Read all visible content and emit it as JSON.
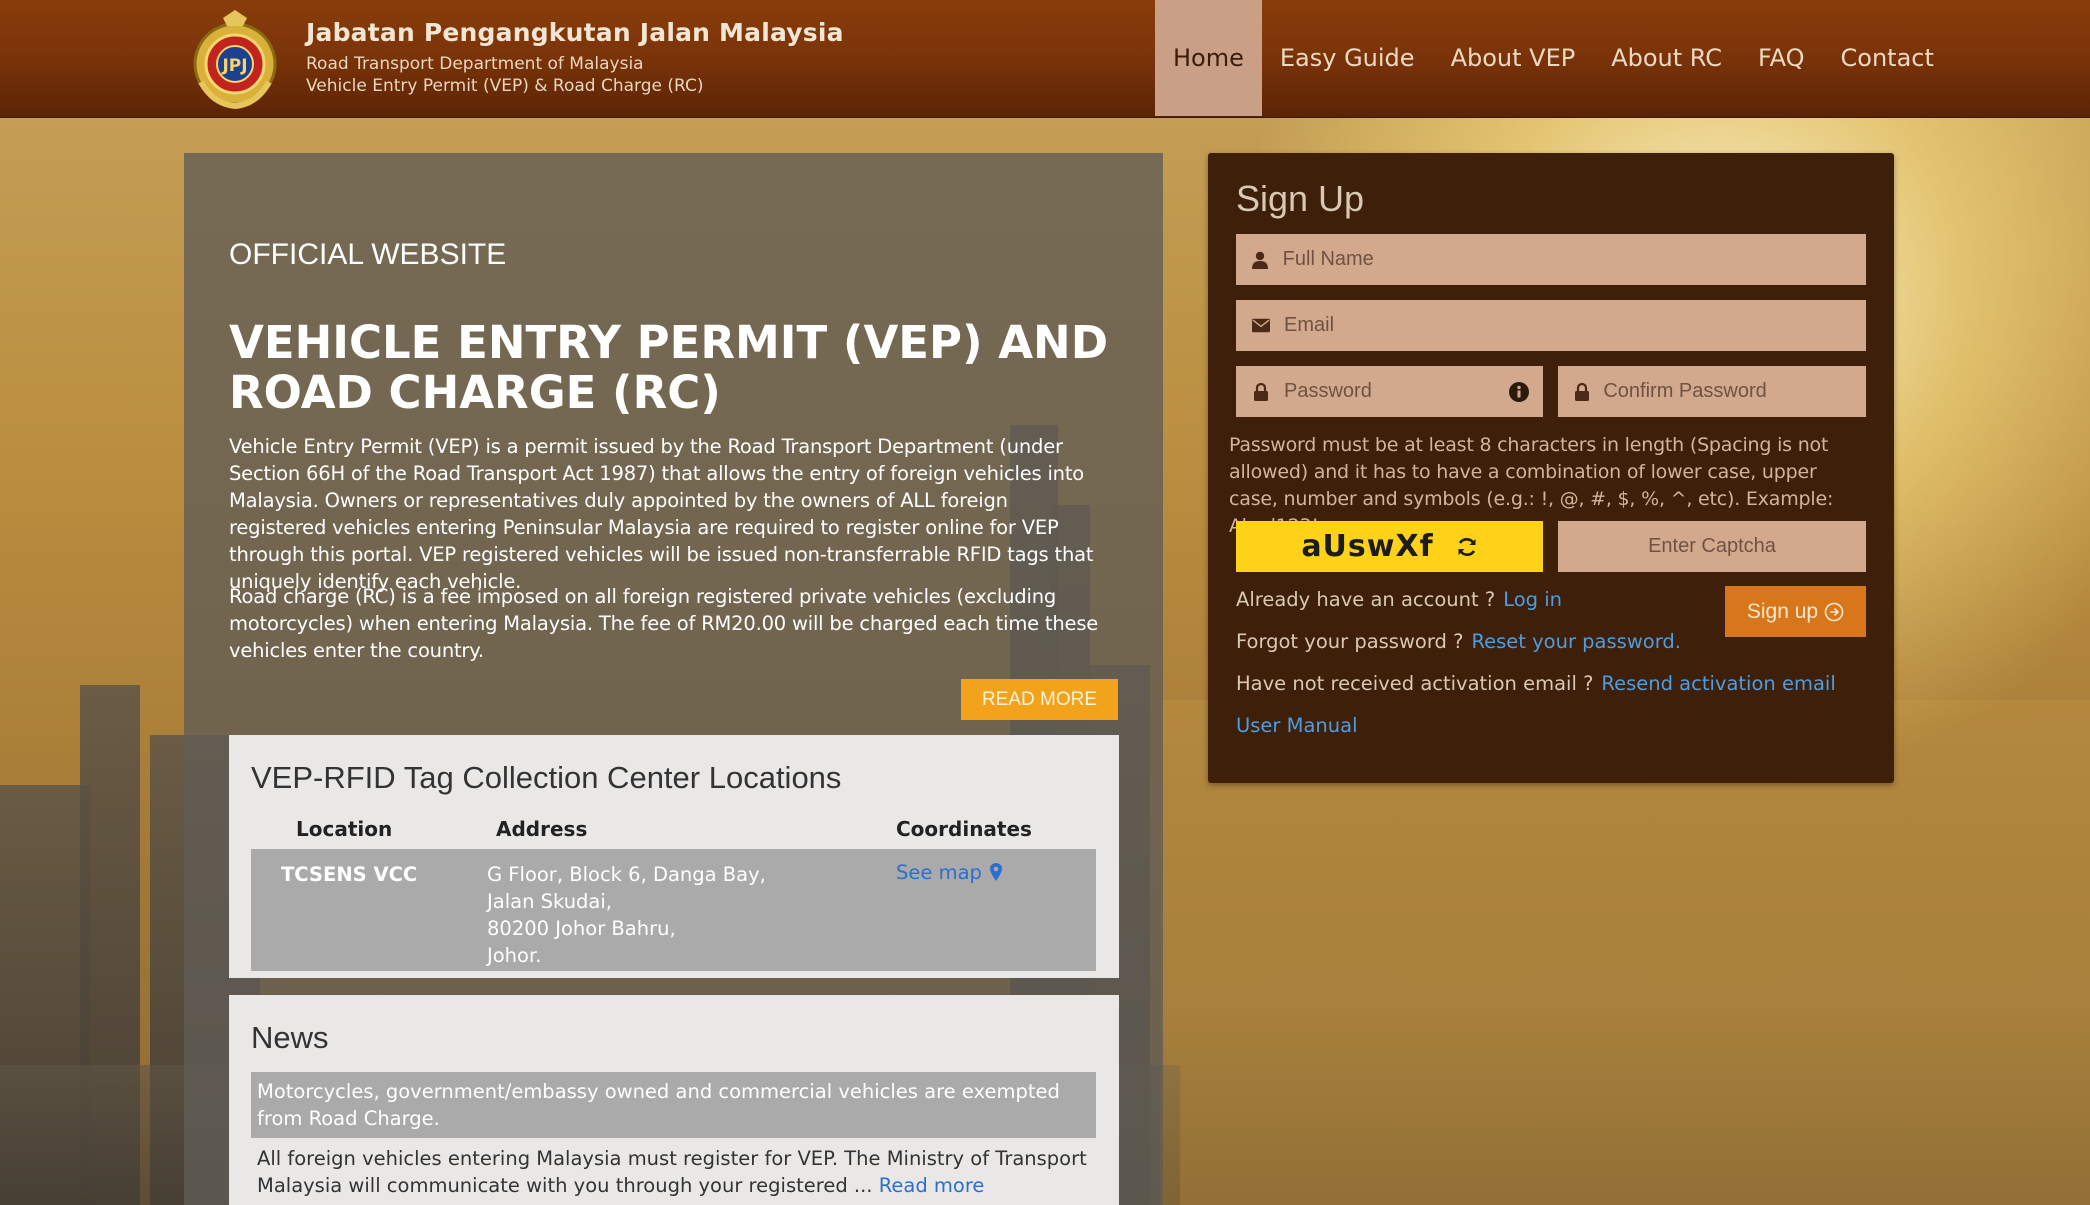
{
  "header": {
    "title": "Jabatan Pengangkutan Jalan Malaysia",
    "subtitle": "Road Transport Department of Malaysia",
    "subtitle2": "Vehicle Entry Permit (VEP) & Road Charge (RC)",
    "logo_letters": "JPJ"
  },
  "nav": {
    "items": [
      {
        "label": "Home",
        "active": true
      },
      {
        "label": "Easy Guide"
      },
      {
        "label": "About VEP"
      },
      {
        "label": "About RC"
      },
      {
        "label": "FAQ"
      },
      {
        "label": "Contact"
      }
    ]
  },
  "intro": {
    "tag": "OFFICIAL WEBSITE",
    "title": "VEHICLE ENTRY PERMIT (VEP) AND ROAD CHARGE (RC)",
    "paragraph1": "Vehicle Entry Permit (VEP) is a permit issued by the Road Transport Department (under Section 66H of the Road Transport Act 1987) that allows the entry of foreign vehicles into Malaysia. Owners or representatives duly appointed by the owners of ALL foreign registered vehicles entering Peninsular Malaysia are required to register online for VEP through this portal. VEP registered vehicles will be issued non-transferrable RFID tags that uniquely identify each vehicle.",
    "paragraph2": "Road charge (RC) is a fee imposed on all foreign registered private vehicles (excluding motorcycles) when entering Malaysia. The fee of RM20.00 will be charged each time these vehicles enter the country.",
    "read_more": "READ MORE"
  },
  "locations": {
    "title": "VEP-RFID Tag Collection Center Locations",
    "columns": [
      "Location",
      "Address",
      "Coordinates"
    ],
    "rows": [
      {
        "location": "TCSENS VCC",
        "address": [
          "G Floor, Block 6, Danga Bay,",
          "Jalan Skudai,",
          "80200 Johor Bahru,",
          "Johor."
        ],
        "map_label": "See map"
      }
    ]
  },
  "news": {
    "title": "News",
    "items": [
      {
        "headline": "Motorcycles, government/embassy owned and commercial vehicles are exempted from Road Charge."
      }
    ],
    "body": "All foreign vehicles entering Malaysia must register for VEP. The Ministry of Transport Malaysia will communicate with you through your registered ...",
    "read_more": "Read more"
  },
  "signup": {
    "title": "Sign Up",
    "full_name_placeholder": "Full Name",
    "email_placeholder": "Email",
    "password_placeholder": "Password",
    "confirm_password_placeholder": "Confirm Password",
    "password_help": "Password must be at least 8 characters in length (Spacing is not allowed) and it has to have a combination of lower case, upper case, number and symbols (e.g.: !, @, #, $, %, ^, etc). Example: Abcd123!",
    "captcha_text": "aUswXf",
    "captcha_placeholder": "Enter Captcha",
    "already_account": "Already have an account ?",
    "login_link": "Log in",
    "forgot_password": "Forgot your password ?",
    "reset_link": "Reset your password.",
    "no_activation": "Have not received activation email ?",
    "resend_link": "Resend activation email",
    "user_manual": "User Manual",
    "submit_label": "Sign up"
  },
  "colors": {
    "header_bg": "#7a3309",
    "nav_active_bg": "#c99f86",
    "signup_bg": "#3e1f09",
    "field_bg": "#d3a98e",
    "accent_orange": "#f2a21b",
    "signup_button": "#d8761c",
    "captcha_bg": "#ffd21a",
    "link_blue": "#4d9de0"
  }
}
